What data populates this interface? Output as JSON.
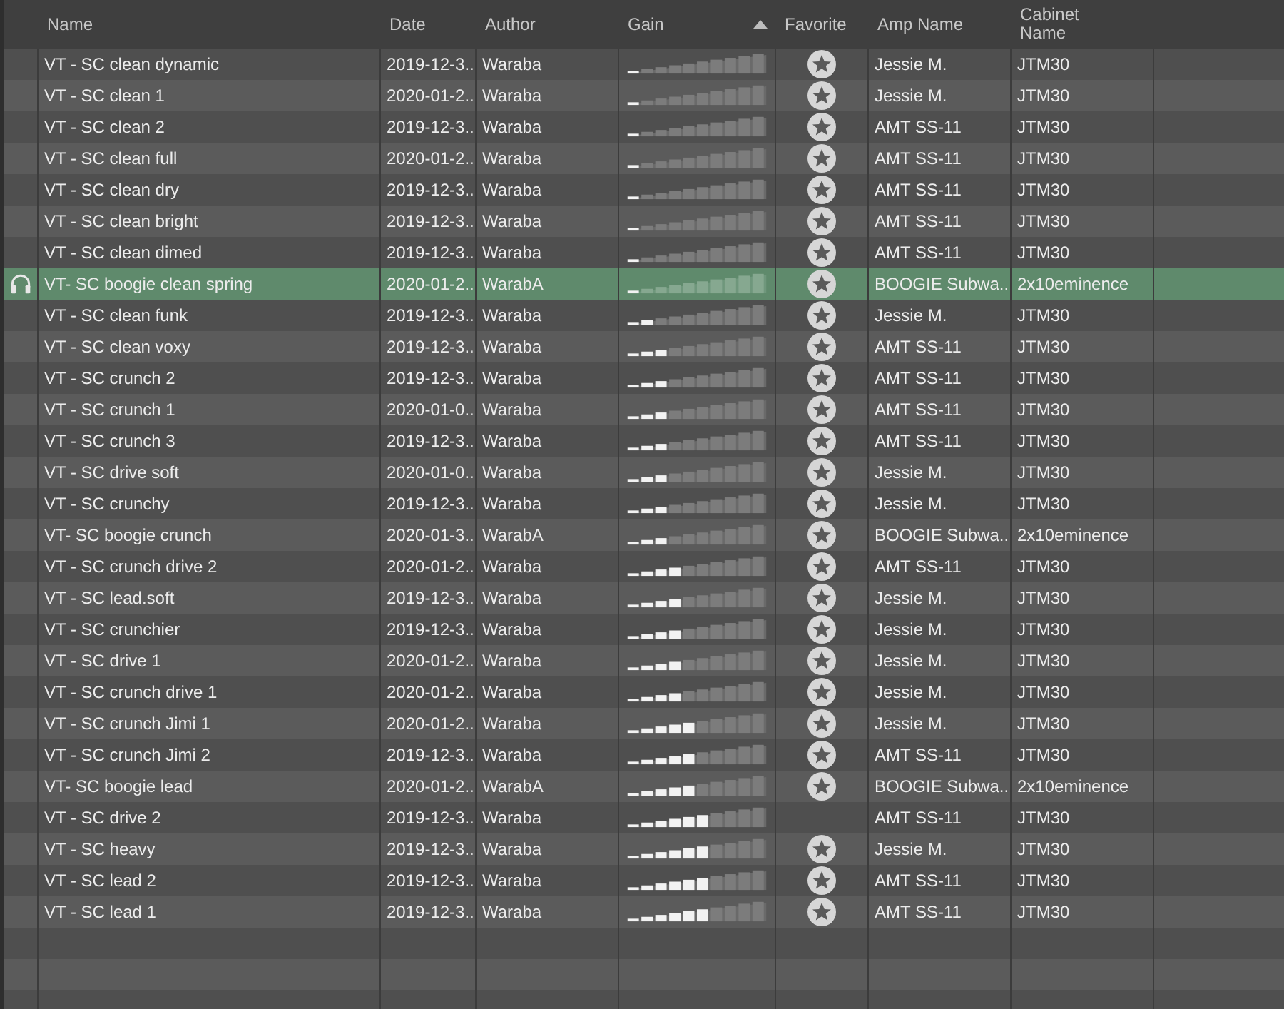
{
  "columns": [
    {
      "label": "Name",
      "sorted": false
    },
    {
      "label": "Date",
      "sorted": false
    },
    {
      "label": "Author",
      "sorted": false
    },
    {
      "label": "Gain",
      "sorted": true
    },
    {
      "label": "Favorite",
      "sorted": false
    },
    {
      "label": "Amp Name",
      "sorted": false
    },
    {
      "label": "Cabinet Name",
      "sorted": false
    }
  ],
  "rows": [
    {
      "name": "VT - SC clean dynamic",
      "date": "2019-12-3...",
      "author": "Waraba",
      "level": 0.1,
      "favorite": true,
      "amp": "Jessie M.",
      "cabinet": "JTM30",
      "selected": false
    },
    {
      "name": "VT - SC clean 1",
      "date": "2020-01-2...",
      "author": "Waraba",
      "level": 0.1,
      "favorite": true,
      "amp": "Jessie M.",
      "cabinet": "JTM30",
      "selected": false
    },
    {
      "name": "VT - SC clean 2",
      "date": "2019-12-3...",
      "author": "Waraba",
      "level": 0.1,
      "favorite": true,
      "amp": "AMT SS-11",
      "cabinet": "JTM30",
      "selected": false
    },
    {
      "name": "VT - SC clean full",
      "date": "2020-01-2...",
      "author": "Waraba",
      "level": 0.1,
      "favorite": true,
      "amp": "AMT SS-11",
      "cabinet": "JTM30",
      "selected": false
    },
    {
      "name": "VT - SC clean dry",
      "date": "2019-12-3...",
      "author": "Waraba",
      "level": 0.1,
      "favorite": true,
      "amp": "AMT SS-11",
      "cabinet": "JTM30",
      "selected": false
    },
    {
      "name": "VT - SC clean bright",
      "date": "2019-12-3...",
      "author": "Waraba",
      "level": 0.1,
      "favorite": true,
      "amp": "AMT SS-11",
      "cabinet": "JTM30",
      "selected": false
    },
    {
      "name": "VT - SC clean dimed",
      "date": "2019-12-3...",
      "author": "Waraba",
      "level": 0.1,
      "favorite": true,
      "amp": "AMT SS-11",
      "cabinet": "JTM30",
      "selected": false
    },
    {
      "name": "VT- SC boogie clean spring",
      "date": "2020-01-2...",
      "author": "WarabA",
      "level": 0.1,
      "favorite": true,
      "amp": "BOOGIE Subwa...",
      "cabinet": "2x10eminence",
      "selected": true
    },
    {
      "name": "VT - SC clean funk",
      "date": "2019-12-3...",
      "author": "Waraba",
      "level": 0.2,
      "favorite": true,
      "amp": "Jessie M.",
      "cabinet": "JTM30",
      "selected": false
    },
    {
      "name": "VT - SC clean voxy",
      "date": "2019-12-3...",
      "author": "Waraba",
      "level": 0.3,
      "favorite": true,
      "amp": "AMT SS-11",
      "cabinet": "JTM30",
      "selected": false
    },
    {
      "name": "VT - SC crunch 2",
      "date": "2019-12-3...",
      "author": "Waraba",
      "level": 0.3,
      "favorite": true,
      "amp": "AMT SS-11",
      "cabinet": "JTM30",
      "selected": false
    },
    {
      "name": "VT - SC crunch 1",
      "date": "2020-01-0...",
      "author": "Waraba",
      "level": 0.3,
      "favorite": true,
      "amp": "AMT SS-11",
      "cabinet": "JTM30",
      "selected": false
    },
    {
      "name": "VT - SC crunch 3",
      "date": "2019-12-3...",
      "author": "Waraba",
      "level": 0.3,
      "favorite": true,
      "amp": "AMT SS-11",
      "cabinet": "JTM30",
      "selected": false
    },
    {
      "name": "VT - SC drive soft",
      "date": "2020-01-0...",
      "author": "Waraba",
      "level": 0.3,
      "favorite": true,
      "amp": "Jessie M.",
      "cabinet": "JTM30",
      "selected": false
    },
    {
      "name": "VT - SC crunchy",
      "date": "2019-12-3...",
      "author": "Waraba",
      "level": 0.3,
      "favorite": true,
      "amp": "Jessie M.",
      "cabinet": "JTM30",
      "selected": false
    },
    {
      "name": "VT- SC boogie crunch",
      "date": "2020-01-3...",
      "author": "WarabA",
      "level": 0.3,
      "favorite": true,
      "amp": "BOOGIE Subwa...",
      "cabinet": "2x10eminence",
      "selected": false
    },
    {
      "name": "VT - SC crunch drive 2",
      "date": "2020-01-2...",
      "author": "Waraba",
      "level": 0.4,
      "favorite": true,
      "amp": "AMT SS-11",
      "cabinet": "JTM30",
      "selected": false
    },
    {
      "name": "VT - SC lead.soft",
      "date": "2019-12-3...",
      "author": "Waraba",
      "level": 0.4,
      "favorite": true,
      "amp": "Jessie M.",
      "cabinet": "JTM30",
      "selected": false
    },
    {
      "name": "VT - SC crunchier",
      "date": "2019-12-3...",
      "author": "Waraba",
      "level": 0.4,
      "favorite": true,
      "amp": "Jessie M.",
      "cabinet": "JTM30",
      "selected": false
    },
    {
      "name": "VT - SC drive 1",
      "date": "2020-01-2...",
      "author": "Waraba",
      "level": 0.4,
      "favorite": true,
      "amp": "Jessie M.",
      "cabinet": "JTM30",
      "selected": false
    },
    {
      "name": "VT - SC crunch drive 1",
      "date": "2020-01-2...",
      "author": "Waraba",
      "level": 0.4,
      "favorite": true,
      "amp": "Jessie M.",
      "cabinet": "JTM30",
      "selected": false
    },
    {
      "name": "VT - SC crunch Jimi 1",
      "date": "2020-01-2...",
      "author": "Waraba",
      "level": 0.5,
      "favorite": true,
      "amp": "Jessie M.",
      "cabinet": "JTM30",
      "selected": false
    },
    {
      "name": "VT - SC crunch Jimi 2",
      "date": "2019-12-3...",
      "author": "Waraba",
      "level": 0.5,
      "favorite": true,
      "amp": "AMT SS-11",
      "cabinet": "JTM30",
      "selected": false
    },
    {
      "name": "VT- SC boogie lead",
      "date": "2020-01-2...",
      "author": "WarabA",
      "level": 0.5,
      "favorite": true,
      "amp": "BOOGIE Subwa...",
      "cabinet": "2x10eminence",
      "selected": false
    },
    {
      "name": "VT - SC drive 2",
      "date": "2019-12-3...",
      "author": "Waraba",
      "level": 0.6,
      "favorite": false,
      "amp": "AMT SS-11",
      "cabinet": "JTM30",
      "selected": false
    },
    {
      "name": "VT - SC heavy",
      "date": "2019-12-3...",
      "author": "Waraba",
      "level": 0.6,
      "favorite": true,
      "amp": "Jessie M.",
      "cabinet": "JTM30",
      "selected": false
    },
    {
      "name": "VT - SC lead 2",
      "date": "2019-12-3...",
      "author": "Waraba",
      "level": 0.6,
      "favorite": true,
      "amp": "AMT SS-11",
      "cabinet": "JTM30",
      "selected": false
    },
    {
      "name": "VT - SC lead 1",
      "date": "2019-12-3...",
      "author": "Waraba",
      "level": 0.6,
      "favorite": true,
      "amp": "AMT SS-11",
      "cabinet": "JTM30",
      "selected": false
    }
  ]
}
